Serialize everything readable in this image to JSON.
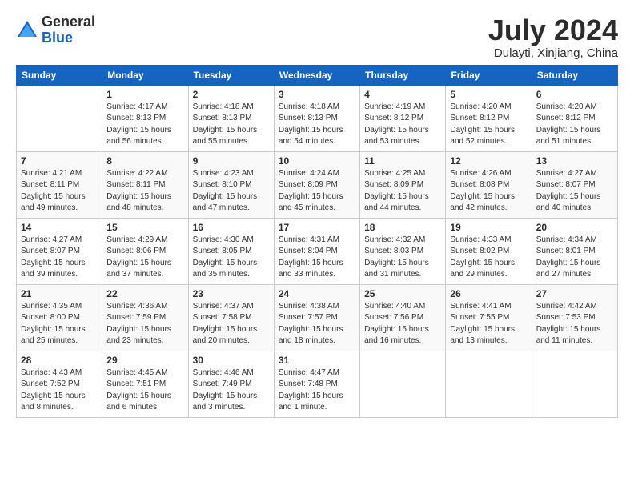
{
  "logo": {
    "general": "General",
    "blue": "Blue"
  },
  "title": {
    "month": "July 2024",
    "location": "Dulayti, Xinjiang, China"
  },
  "headers": [
    "Sunday",
    "Monday",
    "Tuesday",
    "Wednesday",
    "Thursday",
    "Friday",
    "Saturday"
  ],
  "weeks": [
    [
      {
        "day": "",
        "info": ""
      },
      {
        "day": "1",
        "info": "Sunrise: 4:17 AM\nSunset: 8:13 PM\nDaylight: 15 hours\nand 56 minutes."
      },
      {
        "day": "2",
        "info": "Sunrise: 4:18 AM\nSunset: 8:13 PM\nDaylight: 15 hours\nand 55 minutes."
      },
      {
        "day": "3",
        "info": "Sunrise: 4:18 AM\nSunset: 8:13 PM\nDaylight: 15 hours\nand 54 minutes."
      },
      {
        "day": "4",
        "info": "Sunrise: 4:19 AM\nSunset: 8:12 PM\nDaylight: 15 hours\nand 53 minutes."
      },
      {
        "day": "5",
        "info": "Sunrise: 4:20 AM\nSunset: 8:12 PM\nDaylight: 15 hours\nand 52 minutes."
      },
      {
        "day": "6",
        "info": "Sunrise: 4:20 AM\nSunset: 8:12 PM\nDaylight: 15 hours\nand 51 minutes."
      }
    ],
    [
      {
        "day": "7",
        "info": "Sunrise: 4:21 AM\nSunset: 8:11 PM\nDaylight: 15 hours\nand 49 minutes."
      },
      {
        "day": "8",
        "info": "Sunrise: 4:22 AM\nSunset: 8:11 PM\nDaylight: 15 hours\nand 48 minutes."
      },
      {
        "day": "9",
        "info": "Sunrise: 4:23 AM\nSunset: 8:10 PM\nDaylight: 15 hours\nand 47 minutes."
      },
      {
        "day": "10",
        "info": "Sunrise: 4:24 AM\nSunset: 8:09 PM\nDaylight: 15 hours\nand 45 minutes."
      },
      {
        "day": "11",
        "info": "Sunrise: 4:25 AM\nSunset: 8:09 PM\nDaylight: 15 hours\nand 44 minutes."
      },
      {
        "day": "12",
        "info": "Sunrise: 4:26 AM\nSunset: 8:08 PM\nDaylight: 15 hours\nand 42 minutes."
      },
      {
        "day": "13",
        "info": "Sunrise: 4:27 AM\nSunset: 8:07 PM\nDaylight: 15 hours\nand 40 minutes."
      }
    ],
    [
      {
        "day": "14",
        "info": "Sunrise: 4:27 AM\nSunset: 8:07 PM\nDaylight: 15 hours\nand 39 minutes."
      },
      {
        "day": "15",
        "info": "Sunrise: 4:29 AM\nSunset: 8:06 PM\nDaylight: 15 hours\nand 37 minutes."
      },
      {
        "day": "16",
        "info": "Sunrise: 4:30 AM\nSunset: 8:05 PM\nDaylight: 15 hours\nand 35 minutes."
      },
      {
        "day": "17",
        "info": "Sunrise: 4:31 AM\nSunset: 8:04 PM\nDaylight: 15 hours\nand 33 minutes."
      },
      {
        "day": "18",
        "info": "Sunrise: 4:32 AM\nSunset: 8:03 PM\nDaylight: 15 hours\nand 31 minutes."
      },
      {
        "day": "19",
        "info": "Sunrise: 4:33 AM\nSunset: 8:02 PM\nDaylight: 15 hours\nand 29 minutes."
      },
      {
        "day": "20",
        "info": "Sunrise: 4:34 AM\nSunset: 8:01 PM\nDaylight: 15 hours\nand 27 minutes."
      }
    ],
    [
      {
        "day": "21",
        "info": "Sunrise: 4:35 AM\nSunset: 8:00 PM\nDaylight: 15 hours\nand 25 minutes."
      },
      {
        "day": "22",
        "info": "Sunrise: 4:36 AM\nSunset: 7:59 PM\nDaylight: 15 hours\nand 23 minutes."
      },
      {
        "day": "23",
        "info": "Sunrise: 4:37 AM\nSunset: 7:58 PM\nDaylight: 15 hours\nand 20 minutes."
      },
      {
        "day": "24",
        "info": "Sunrise: 4:38 AM\nSunset: 7:57 PM\nDaylight: 15 hours\nand 18 minutes."
      },
      {
        "day": "25",
        "info": "Sunrise: 4:40 AM\nSunset: 7:56 PM\nDaylight: 15 hours\nand 16 minutes."
      },
      {
        "day": "26",
        "info": "Sunrise: 4:41 AM\nSunset: 7:55 PM\nDaylight: 15 hours\nand 13 minutes."
      },
      {
        "day": "27",
        "info": "Sunrise: 4:42 AM\nSunset: 7:53 PM\nDaylight: 15 hours\nand 11 minutes."
      }
    ],
    [
      {
        "day": "28",
        "info": "Sunrise: 4:43 AM\nSunset: 7:52 PM\nDaylight: 15 hours\nand 8 minutes."
      },
      {
        "day": "29",
        "info": "Sunrise: 4:45 AM\nSunset: 7:51 PM\nDaylight: 15 hours\nand 6 minutes."
      },
      {
        "day": "30",
        "info": "Sunrise: 4:46 AM\nSunset: 7:49 PM\nDaylight: 15 hours\nand 3 minutes."
      },
      {
        "day": "31",
        "info": "Sunrise: 4:47 AM\nSunset: 7:48 PM\nDaylight: 15 hours\nand 1 minute."
      },
      {
        "day": "",
        "info": ""
      },
      {
        "day": "",
        "info": ""
      },
      {
        "day": "",
        "info": ""
      }
    ]
  ]
}
